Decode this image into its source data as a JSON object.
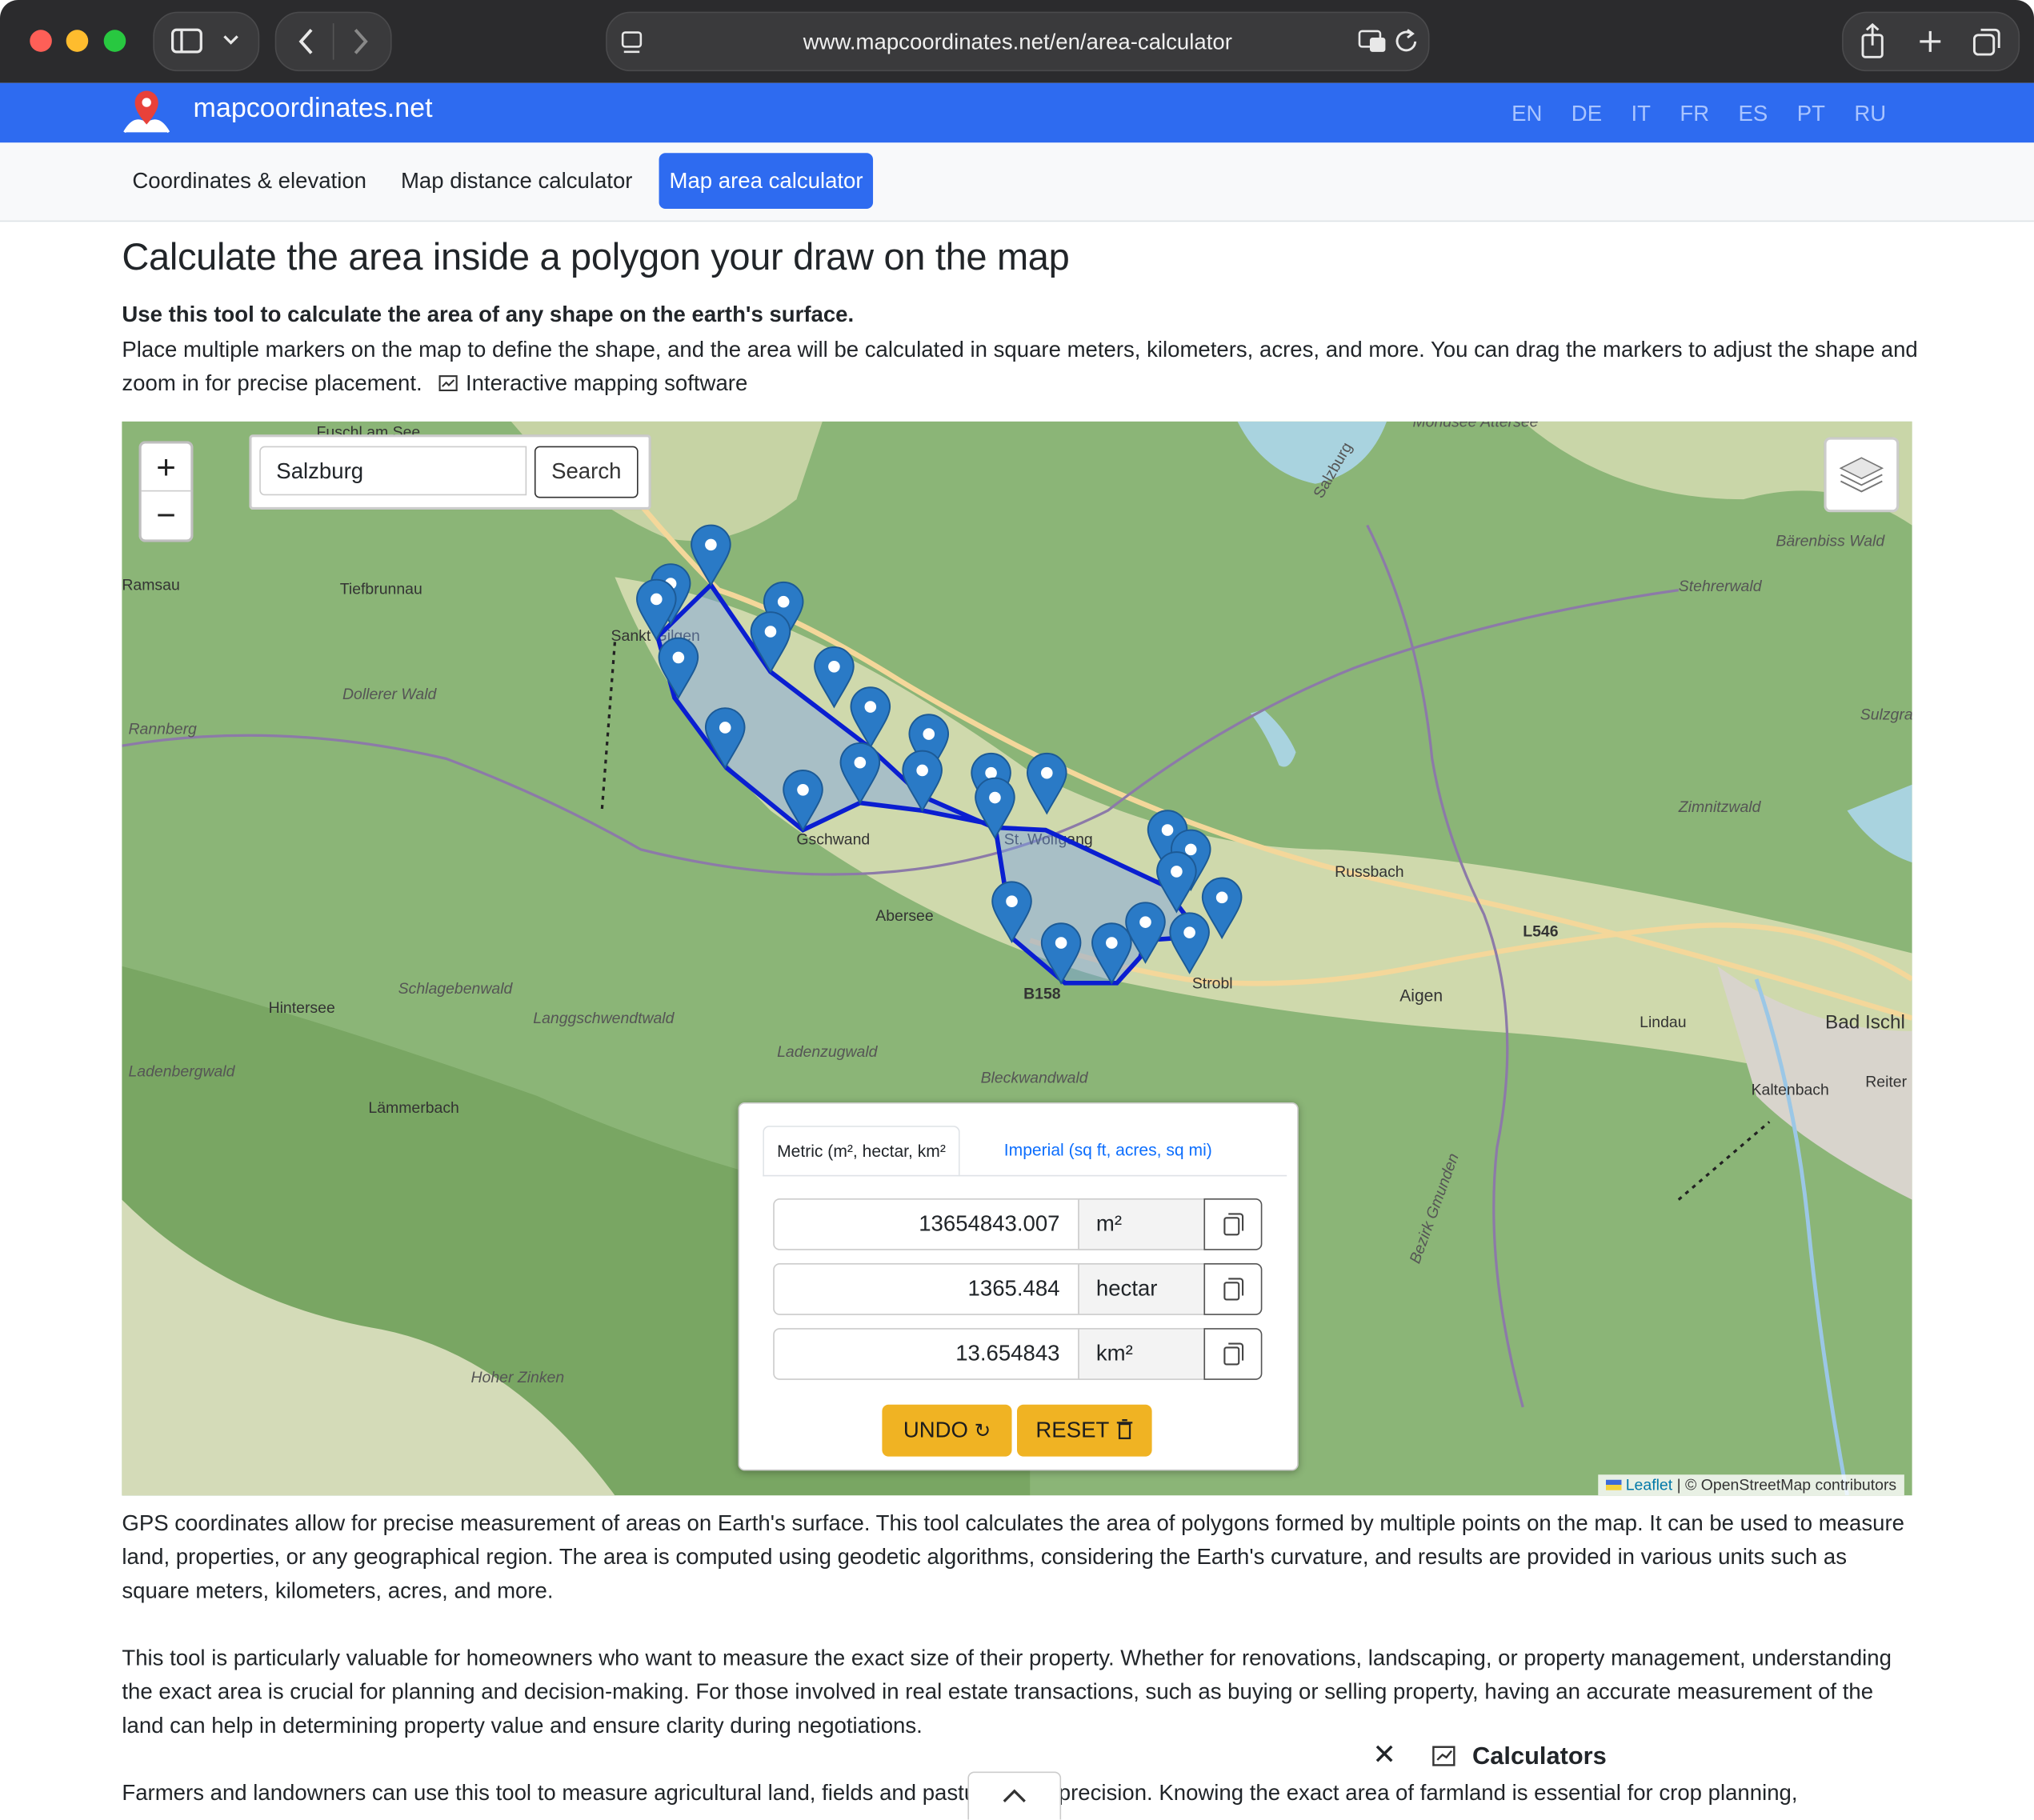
{
  "browser": {
    "url": "www.mapcoordinates.net/en/area-calculator"
  },
  "site": {
    "brand": "mapcoordinates.net",
    "languages": [
      "EN",
      "DE",
      "IT",
      "FR",
      "ES",
      "PT",
      "RU"
    ]
  },
  "nav": {
    "items": [
      "Coordinates & elevation",
      "Map distance calculator",
      "Map area calculator"
    ],
    "active": "Map area calculator"
  },
  "page": {
    "title": "Calculate the area inside a polygon your draw on the map",
    "lead": "Use this tool to calculate the area of any shape on the earth's surface.",
    "description": "Place multiple markers on the map to define the shape, and the area will be calculated in square meters, kilometers, acres, and more. You can drag the markers to adjust the shape and zoom in for precise placement.",
    "software_link": "Interactive mapping software"
  },
  "map": {
    "search_value": "Salzburg",
    "search_button": "Search",
    "zoom_in": "+",
    "zoom_out": "−",
    "attribution_leaflet": "Leaflet",
    "attribution_osm": "| © OpenStreetMap contributors",
    "places": [
      "Fuschl am See",
      "Ramsau",
      "Tiefbrunnau",
      "Sankt Gilgen",
      "Dollerer Wald",
      "Rannberg",
      "Gschwand",
      "St. Wolfgang",
      "Abersee",
      "Russbach",
      "Strobl",
      "B158",
      "L546",
      "Aigen",
      "Lindau",
      "Bad Ischl",
      "Kaltenbach",
      "Reiter",
      "Hintersee",
      "Schlagebenwald",
      "Langgschwendtwald",
      "Ladenzugwald",
      "Bleckwandwald",
      "Ladenbergwald",
      "Lämmerbach",
      "Hoher Zinken",
      "Stehrerwald",
      "Sulzgraben Politzwald",
      "Zimnitzwald",
      "Bärenbiss Wald",
      "Bezirk Gmunden",
      "Salzburg",
      "Mondsee Attersee"
    ],
    "polygon_markers": 24,
    "colors": {
      "polygon_stroke": "#0a1ed1",
      "marker": "#2a7ac6",
      "map_green": "#7fab6a"
    }
  },
  "results": {
    "tab_metric": "Metric (m², hectar, km²",
    "tab_imperial": "Imperial (sq ft, acres, sq mi)",
    "rows": [
      {
        "value": "13654843.007",
        "unit": "m²"
      },
      {
        "value": "1365.484",
        "unit": "hectar"
      },
      {
        "value": "13.654843",
        "unit": "km²"
      }
    ],
    "undo_label": "UNDO",
    "reset_label": "RESET"
  },
  "body": {
    "para1": "GPS coordinates allow for precise measurement of areas on Earth's surface. This tool calculates the area of polygons formed by multiple points on the map. It can be used to measure land, properties, or any geographical region. The area is computed using geodetic algorithms, considering the Earth's curvature, and results are provided in various units such as square meters, kilometers, acres, and more.",
    "para2": "This tool is particularly valuable for homeowners who want to measure the exact size of their property. Whether for renovations, landscaping, or property management, understanding the exact area is crucial for planning and decision-making. For those involved in real estate transactions, such as buying or selling property, having an accurate measurement of the land can help in determining property value and ensure clarity during negotiations.",
    "para3": "Farmers and landowners can use this tool to measure agricultural land, fields and pastures with precision. Knowing the exact area of farmland is essential for crop planning,"
  },
  "calculators_bar": {
    "label": "Calculators"
  }
}
